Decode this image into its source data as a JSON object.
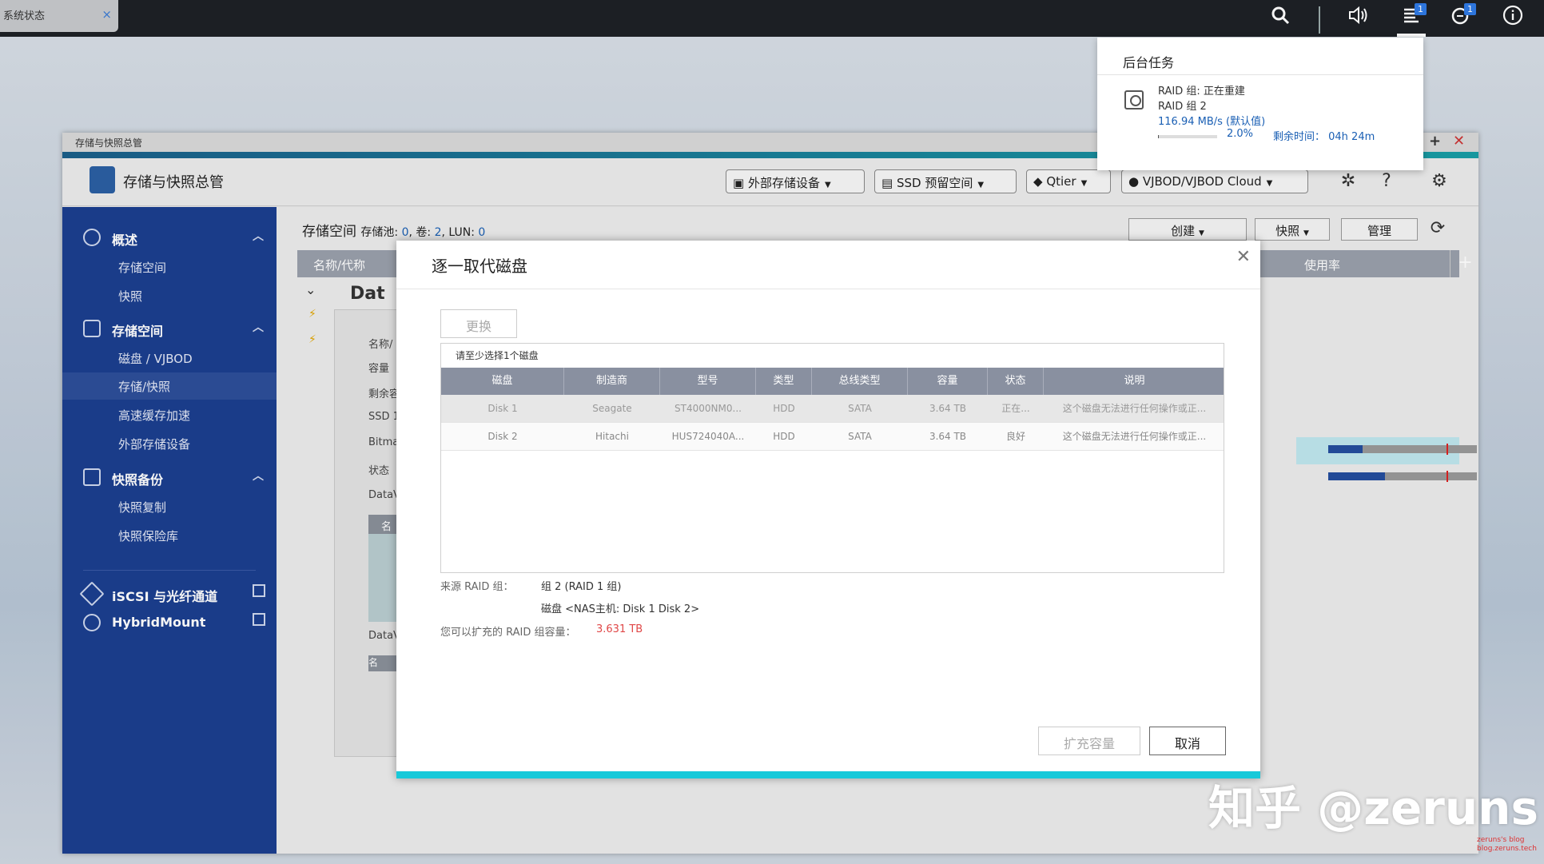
{
  "taskbar": {
    "tab_label": "系统状态",
    "tab_close": "×"
  },
  "topbar": {
    "badge_tasks": "1",
    "badge_notify": "1"
  },
  "bg_tasks": {
    "title": "后台任务",
    "line1": "RAID 组: 正在重建",
    "line2": "RAID 组 2",
    "line3": "116.94 MB/s (默认值)",
    "progress_text": "2.0%",
    "progress": 0.02,
    "remaining": "剩余时间： 04h 24m"
  },
  "window": {
    "title": "存储与快照总管",
    "app_title": "存储与快照总管",
    "plus": "+",
    "close": "✕"
  },
  "header": {
    "ext_storage": "外部存储设备",
    "ssd": "SSD 预留空间",
    "qtier": "Qtier",
    "vjbod": "VJBOD/VJBOD Cloud"
  },
  "sidebar": {
    "overview": "概述",
    "overview_items": [
      "存储空间",
      "快照"
    ],
    "storage": "存储空间",
    "storage_items": [
      "磁盘 / VJBOD",
      "存储/快照",
      "高速缓存加速",
      "外部存储设备"
    ],
    "snapshot": "快照备份",
    "snapshot_items": [
      "快照复制",
      "快照保险库"
    ],
    "iscsi": "iSCSI 与光纤通道",
    "hybrid": "HybridMount"
  },
  "content": {
    "crumb_title": "存储空间",
    "crumb_pool_label": "存储池:",
    "crumb_pool": "0",
    "crumb_vol_label": "卷:",
    "crumb_vol": "2",
    "crumb_lun_label": "LUN:",
    "crumb_lun": "0",
    "create": "创建",
    "snapshot": "快照",
    "manage": "管理",
    "col_name": "名称/代称",
    "col_usage": "使用率",
    "usage1": 0.23,
    "usage2": 0.38,
    "partial_dat": "Dat",
    "inner_labels": [
      "名称/",
      "容量",
      "剩余容",
      "SSD 1",
      "Bitma",
      "状态",
      "DataV",
      "名",
      "DataV",
      "名"
    ]
  },
  "dialog": {
    "title": "逐一取代磁盘",
    "replace_btn": "更换",
    "note": "请至少选择1个磁盘",
    "columns": [
      "磁盘",
      "制造商",
      "型号",
      "类型",
      "总线类型",
      "容量",
      "状态",
      "说明"
    ],
    "rows": [
      [
        "Disk 1",
        "Seagate",
        "ST4000NM0...",
        "HDD",
        "SATA",
        "3.64 TB",
        "正在...",
        "这个磁盘无法进行任何操作或正..."
      ],
      [
        "Disk 2",
        "Hitachi",
        "HUS724040A...",
        "HDD",
        "SATA",
        "3.64 TB",
        "良好",
        "这个磁盘无法进行任何操作或正..."
      ]
    ],
    "src_label": "来源 RAID 组：",
    "src_value": "组 2 (RAID 1 组)",
    "disk_value": "磁盘 <NAS主机: Disk 1 Disk 2>",
    "cap_label": "您可以扩充的 RAID 组容量：",
    "cap_value": "3.631 TB",
    "expand_btn": "扩充容量",
    "cancel_btn": "取消"
  },
  "watermark": {
    "main": "知乎 @zeruns",
    "blog1": "zeruns's blog",
    "blog2": "blog.zeruns.tech"
  }
}
